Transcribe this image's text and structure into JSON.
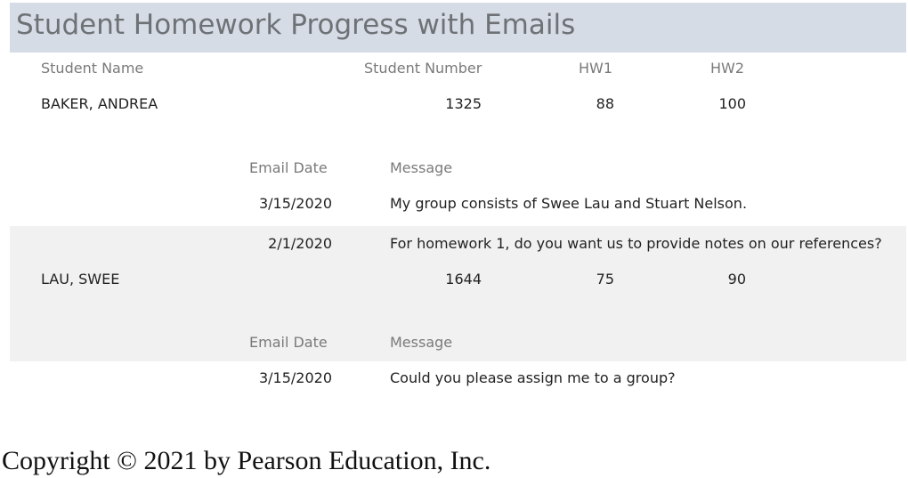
{
  "report": {
    "title": "Student Homework Progress with Emails",
    "columns": {
      "student_name": "Student Name",
      "student_number": "Student Number",
      "hw1": "HW1",
      "hw2": "HW2"
    },
    "subcolumns": {
      "email_date": "Email Date",
      "message": "Message"
    },
    "students": [
      {
        "name": "BAKER, ANDREA",
        "number": "1325",
        "hw1": "88",
        "hw2": "100",
        "emails": [
          {
            "date": "3/15/2020",
            "message": "My group consists of Swee Lau and Stuart Nelson."
          },
          {
            "date": "2/1/2020",
            "message": "For homework 1, do you want us to provide notes on our references?"
          }
        ]
      },
      {
        "name": "LAU, SWEE",
        "number": "1644",
        "hw1": "75",
        "hw2": "90",
        "emails": [
          {
            "date": "3/15/2020",
            "message": "Could you please assign me to a group?"
          }
        ]
      }
    ]
  },
  "footer": {
    "copyright": "Copyright © 2021 by Pearson Education, Inc."
  }
}
